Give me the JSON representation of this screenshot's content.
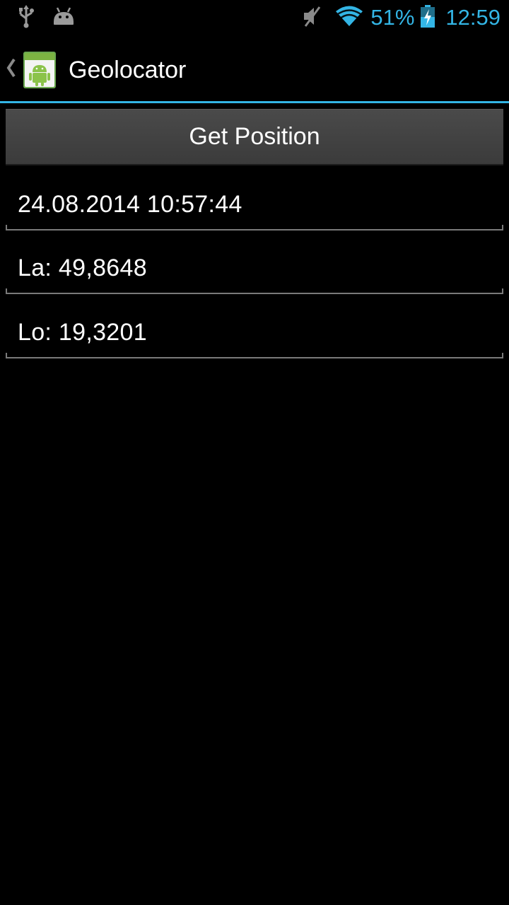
{
  "status_bar": {
    "battery_percent": "51%",
    "time": "12:59",
    "accent_color": "#33B5E5",
    "icons": [
      "usb-icon",
      "android-debug-icon",
      "muted-speaker-icon",
      "wifi-icon",
      "battery-charging-icon"
    ]
  },
  "action_bar": {
    "title": "Geolocator",
    "up_icon": "chevron-left-icon",
    "app_icon": "android-app-icon",
    "divider_color": "#33B5E5"
  },
  "main": {
    "get_position_label": "Get Position",
    "datetime_value": "24.08.2014 10:57:44",
    "latitude_value": "La: 49,8648",
    "longitude_value": "Lo: 19,3201"
  }
}
